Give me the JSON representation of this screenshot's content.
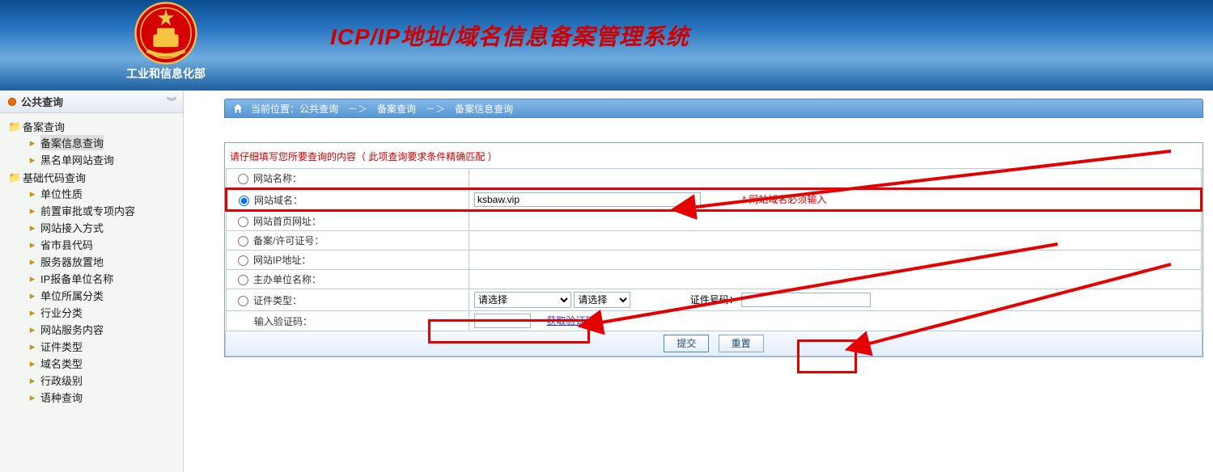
{
  "header": {
    "ministry": "工业和信息化部",
    "title": "ICP/IP地址/域名信息备案管理系统"
  },
  "sidebar": {
    "heading": "公共查询",
    "groups": [
      {
        "label": "备案查询",
        "items": [
          {
            "label": "备案信息查询",
            "active": true
          },
          {
            "label": "黑名单网站查询"
          }
        ]
      },
      {
        "label": "基础代码查询",
        "items": [
          {
            "label": "单位性质"
          },
          {
            "label": "前置审批或专项内容"
          },
          {
            "label": "网站接入方式"
          },
          {
            "label": "省市县代码"
          },
          {
            "label": "服务器放置地"
          },
          {
            "label": "IP报备单位名称"
          },
          {
            "label": "单位所属分类"
          },
          {
            "label": "行业分类"
          },
          {
            "label": "网站服务内容"
          },
          {
            "label": "证件类型"
          },
          {
            "label": "域名类型"
          },
          {
            "label": "行政级别"
          },
          {
            "label": "语种查询"
          }
        ]
      }
    ]
  },
  "breadcrumb": {
    "prefix": "当前位置：",
    "items": [
      "公共查询",
      "备案查询",
      "备案信息查询"
    ],
    "sep": "－＞"
  },
  "form": {
    "note": "请仔细填写您所要查询的内容（ 此项查询要求条件精确匹配 ）",
    "rows": {
      "site_name": "网站名称：",
      "site_domain": "网站域名：",
      "site_homepage": "网站首页网址：",
      "record_no": "备案/许可证号：",
      "site_ip": "网站IP地址：",
      "sponsor_name": "主办单位名称：",
      "cert_type": "证件类型：",
      "captcha": "输入验证码："
    },
    "domain_value": "ksbaw.vip",
    "domain_required_msg": "* 网站域名必须输入",
    "select_placeholder": "请选择",
    "cert_no_label": "证件号码：",
    "get_code": "获取验证码",
    "submit": "提交",
    "reset": "重置"
  }
}
